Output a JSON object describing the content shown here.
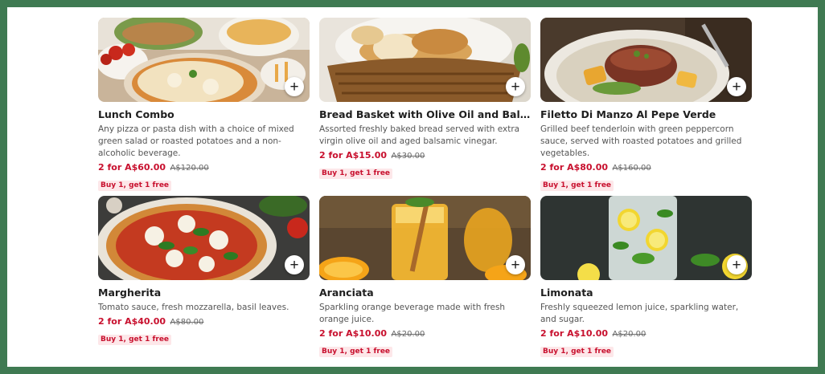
{
  "menu": {
    "add_symbol": "+",
    "items": [
      {
        "name": "Lunch Combo",
        "image": "pizza-fries-salad-photo",
        "description": "Any pizza or pasta dish with a choice of mixed green salad or roasted potatoes and a non-alcoholic beverage.",
        "price": "2 for A$60.00",
        "original_price": "A$120.00",
        "promo": "Buy 1, get 1 free"
      },
      {
        "name": "Bread Basket with Olive Oil and Balsamic Vine...",
        "image": "bread-basket-photo",
        "description": "Assorted freshly baked bread served with extra virgin olive oil and aged balsamic vinegar.",
        "price": "2 for A$15.00",
        "original_price": "A$30.00",
        "promo": "Buy 1, get 1 free"
      },
      {
        "name": "Filetto Di Manzo Al Pepe Verde",
        "image": "beef-tenderloin-photo",
        "description": "Grilled beef tenderloin with green peppercorn sauce, served with roasted potatoes and grilled vegetables.",
        "price": "2 for A$80.00",
        "original_price": "A$160.00",
        "promo": "Buy 1, get 1 free"
      },
      {
        "name": "Margherita",
        "image": "margherita-pizza-photo",
        "description": "Tomato sauce, fresh mozzarella, basil leaves.",
        "price": "2 for A$40.00",
        "original_price": "A$80.00",
        "promo": "Buy 1, get 1 free"
      },
      {
        "name": "Aranciata",
        "image": "orange-drink-photo",
        "description": "Sparkling orange beverage made with fresh orange juice.",
        "price": "2 for A$10.00",
        "original_price": "A$20.00",
        "promo": "Buy 1, get 1 free"
      },
      {
        "name": "Limonata",
        "image": "lemonade-photo",
        "description": "Freshly squeezed lemon juice, sparkling water, and sugar.",
        "price": "2 for A$10.00",
        "original_price": "A$20.00",
        "promo": "Buy 1, get 1 free"
      }
    ]
  },
  "colors": {
    "frame_border": "#3f7a52",
    "price": "#c8102e",
    "badge_bg": "#fde7e9"
  }
}
